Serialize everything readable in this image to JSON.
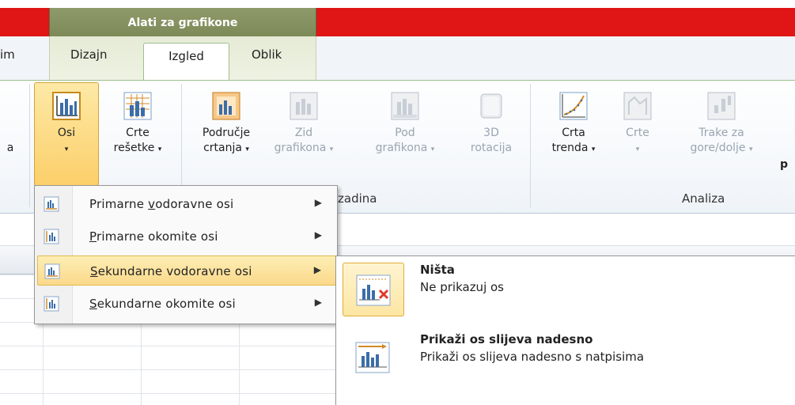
{
  "title_bar": {
    "context_title": "Alati za grafikone"
  },
  "tabs": [
    {
      "label": "im",
      "active": false
    },
    {
      "label": "Dizajn",
      "active": false
    },
    {
      "label": "Izgled",
      "active": true
    },
    {
      "label": "Oblik",
      "active": false
    }
  ],
  "ribbon": {
    "partial_left": "a",
    "osi": {
      "label": "Osi",
      "arrow": "▾"
    },
    "crte_resetke": {
      "line1": "Crte",
      "line2": "rešetke",
      "arrow": "▾"
    },
    "podrucje": {
      "line1": "Područje",
      "line2": "crtanja",
      "arrow": "▾"
    },
    "zid": {
      "line1": "Zid",
      "line2": "grafikona",
      "arrow": "▾"
    },
    "pod": {
      "line1": "Pod",
      "line2": "grafikona",
      "arrow": "▾"
    },
    "rotacija": {
      "line1": "3D",
      "line2": "rotacija"
    },
    "crta_trenda": {
      "line1": "Crta",
      "line2": "trenda",
      "arrow": "▾"
    },
    "crte": {
      "line1": "Crte",
      "arrow": "▾"
    },
    "trake": {
      "line1": "Trake za",
      "line2": "gore/dolje",
      "arrow": "▾"
    },
    "partial_right": "p",
    "groups": {
      "pozadina": "zadina",
      "analiza": "Analiza"
    }
  },
  "axes_menu": {
    "items": [
      {
        "pre": "Primarne ",
        "ul": "v",
        "post": "odoravne osi",
        "icon": "horizontal-axis-icon",
        "highlighted": false
      },
      {
        "pre": "",
        "ul": "P",
        "post": "rimarne okomite osi",
        "icon": "vertical-axis-icon",
        "highlighted": false
      },
      {
        "pre": "",
        "ul": "S",
        "post": "ekundarne vodoravne osi",
        "icon": "horizontal-axis-icon",
        "highlighted": true
      },
      {
        "pre": "",
        "ul": "S",
        "post": "ekundarne okomite osi",
        "icon": "vertical-axis-icon",
        "highlighted": false
      }
    ],
    "arrow": "▶"
  },
  "submenu": {
    "items": [
      {
        "title": "Ništa",
        "desc": "Ne prikazuj os",
        "icon": "no-axis-icon"
      },
      {
        "title": "Prikaži os slijeva nadesno",
        "desc": "Prikaži os slijeva nadesno s natpisima",
        "icon": "axis-left-to-right-icon"
      }
    ]
  },
  "colors": {
    "title_red": "#e01515",
    "context_green": "#7d8a58",
    "highlight": "#fbd98b"
  }
}
